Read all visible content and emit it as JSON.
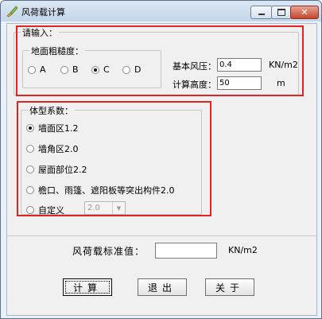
{
  "window": {
    "title": "风荷载计算",
    "app_icon": "brush-icon",
    "controls": {
      "minimize": "minimize-icon",
      "maximize": "maximize-icon",
      "close": "close-icon"
    }
  },
  "input_group": {
    "label": "请输入：",
    "terrain": {
      "label": "地面粗糙度：",
      "options": [
        {
          "label": "A",
          "selected": false
        },
        {
          "label": "B",
          "selected": false
        },
        {
          "label": "C",
          "selected": true
        },
        {
          "label": "D",
          "selected": false
        }
      ]
    },
    "wind_pressure": {
      "label": "基本风压：",
      "value": "0.4",
      "unit": "KN/m2"
    },
    "height": {
      "label": "计算高度：",
      "value": "50",
      "unit": "m"
    }
  },
  "shape_group": {
    "label": "体型系数：",
    "options": [
      {
        "label": "墙面区1.2",
        "selected": true
      },
      {
        "label": "墙角区2.0",
        "selected": false
      },
      {
        "label": "屋面部位2.2",
        "selected": false
      },
      {
        "label": "檐口、雨篷、遮阳板等突出构件2.0",
        "selected": false
      },
      {
        "label": "自定义",
        "selected": false
      }
    ],
    "custom_value": "2.0"
  },
  "result": {
    "label": "风荷载标准值：",
    "value": "",
    "unit": "KN/m2"
  },
  "buttons": {
    "calculate": "计算",
    "exit": "退出",
    "about": "关于"
  },
  "highlight_color": "#e02424"
}
